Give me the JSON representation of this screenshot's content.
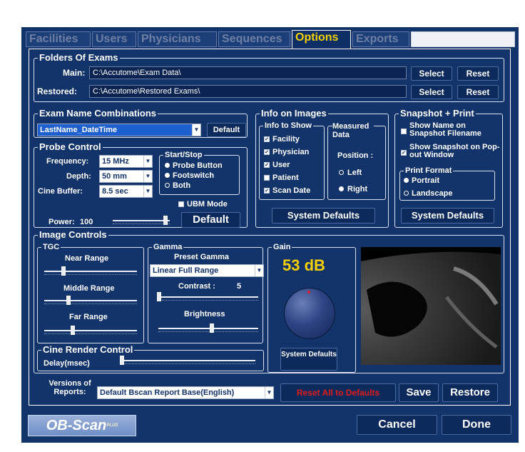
{
  "tabs": [
    "Facilities",
    "Users",
    "Physicians",
    "Sequences",
    "Options",
    "Exports"
  ],
  "active_tab": "Options",
  "folders": {
    "title": "Folders Of Exams",
    "main_label": "Main:",
    "main_value": "C:\\Accutome\\Exam Data\\",
    "restored_label": "Restored:",
    "restored_value": "C:\\Accutome\\Restored Exams\\",
    "select_label": "Select",
    "reset_label": "Reset"
  },
  "exam_name": {
    "title": "Exam Name Combinations",
    "value": "LastName_DateTime",
    "default_label": "Default"
  },
  "probe": {
    "title": "Probe Control",
    "frequency_label": "Frequency:",
    "frequency_value": "15 MHz",
    "depth_label": "Depth:",
    "depth_value": "50 mm",
    "cine_label": "Cine Buffer:",
    "cine_value": "8.5 sec",
    "startstop_title": "Start/Stop",
    "startstop_options": [
      "Probe Button",
      "Footswitch",
      "Both"
    ],
    "ubm_label": "UBM Mode",
    "power_label": "Power:",
    "power_value": "100",
    "default_label": "Default"
  },
  "info_images": {
    "title": "Info on Images",
    "info_to_show_title": "Info to Show",
    "items": [
      "Facility",
      "Physician",
      "User",
      "Patient",
      "Scan Date"
    ],
    "measured_title": "Measured Data",
    "position_label": "Position :",
    "left_label": "Left",
    "right_label": "Right",
    "system_defaults_label": "System Defaults"
  },
  "snapshot": {
    "title": "Snapshot + Print",
    "opt1": "Show Name on Snapshot Filename",
    "opt2": "Show Snapshot on Pop-out Window",
    "print_format_title": "Print Format",
    "portrait_label": "Portrait",
    "landscape_label": "Landscape",
    "system_defaults_label": "System Defaults"
  },
  "image_controls": {
    "title": "Image Controls",
    "tgc_title": "TGC",
    "near_label": "Near Range",
    "middle_label": "Middle Range",
    "far_label": "Far Range",
    "gamma_title": "Gamma",
    "preset_label": "Preset Gamma",
    "preset_value": "Linear Full Range",
    "contrast_label": "Contrast :",
    "contrast_value": "5",
    "brightness_label": "Brightness",
    "gain_title": "Gain",
    "gain_value": "53 dB",
    "system_defaults_label": "System Defaults",
    "cine_title": "Cine Render Control",
    "delay_label": "Delay(msec)"
  },
  "footer": {
    "versions_label": "Versions of Reports:",
    "versions_value": "Default Bscan Report Base(English)",
    "reset_all_label": "Reset All to Defaults",
    "save_label": "Save",
    "restore_label": "Restore",
    "cancel_label": "Cancel",
    "done_label": "Done",
    "logo_text": "OB-Scan",
    "logo_sup": "PLUS"
  },
  "colors": {
    "background": "#13336b",
    "accent_yellow": "#f5d000",
    "reset_red": "#e11b1b"
  }
}
